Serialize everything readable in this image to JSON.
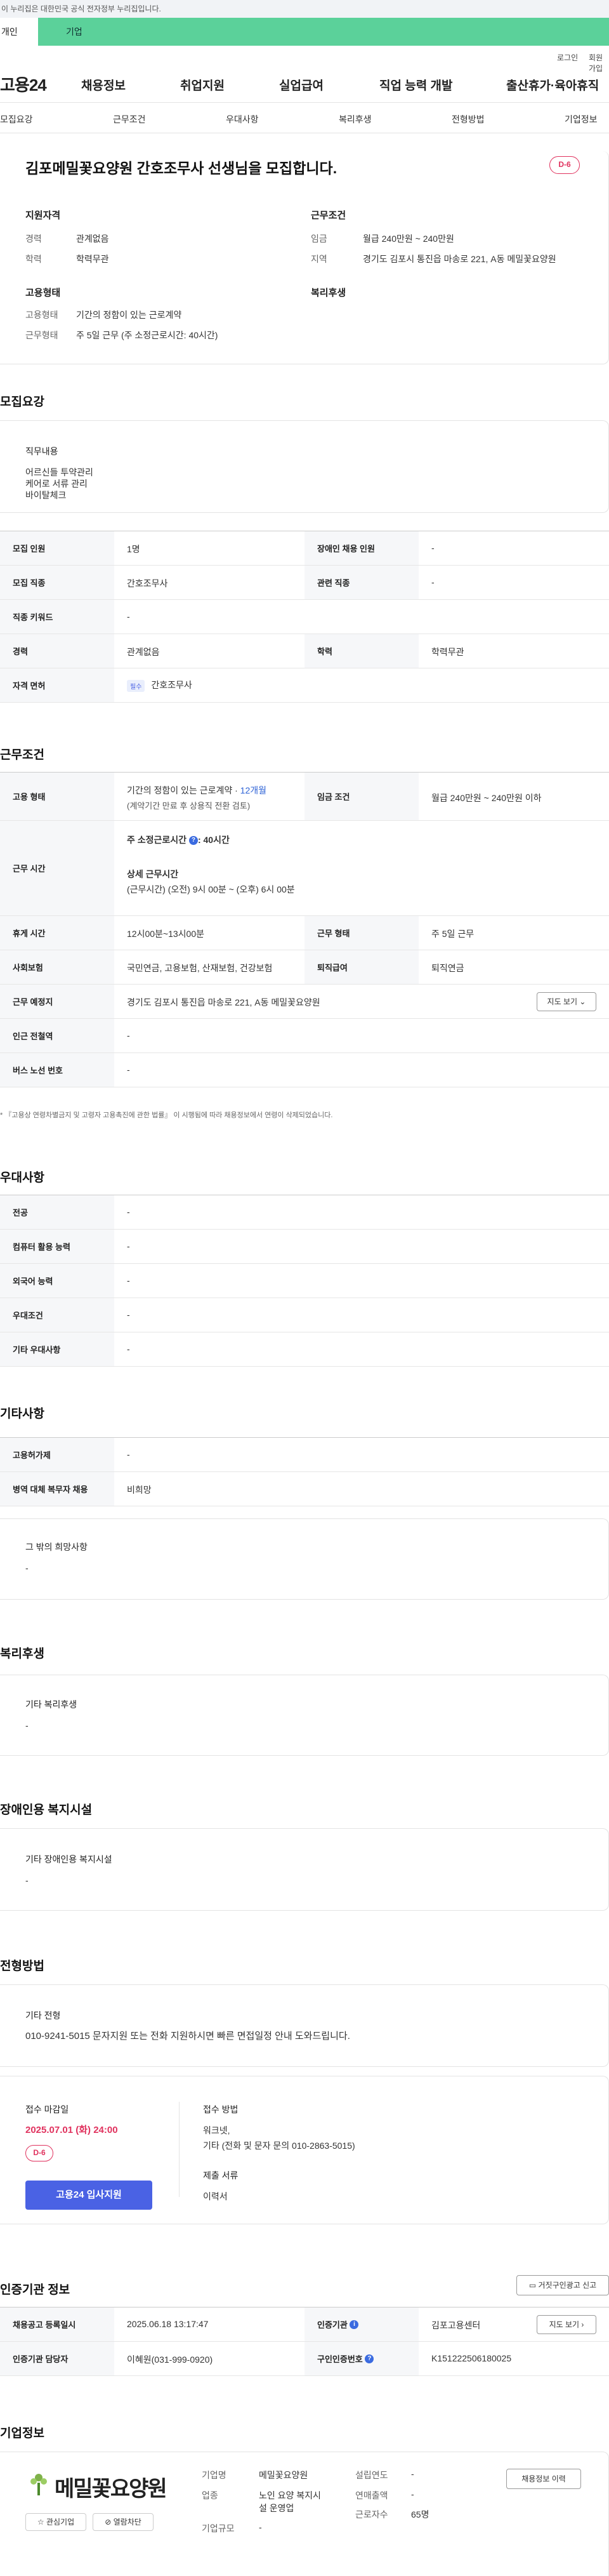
{
  "gov_bar": "이 누리집은 대한민국 공식 전자정부 누리집입니다.",
  "top_tabs": {
    "personal": "개인",
    "company": "기업"
  },
  "util": {
    "login": "로그인",
    "join": "회원가입"
  },
  "logo": "고용24",
  "gnb": [
    "채용정보",
    "취업지원",
    "실업급여",
    "직업 능력 개발",
    "출산휴가·육아휴직"
  ],
  "subnav": [
    "모집요강",
    "근무조건",
    "우대사항",
    "복리후생",
    "전형방법",
    "기업정보"
  ],
  "job": {
    "title": "김포메밀꽃요양원 간호조무사 선생님을 모집합니다.",
    "dday": "D-6",
    "summary": {
      "qual_head": "지원자격",
      "career_k": "경력",
      "career_v": "관계없음",
      "edu_k": "학력",
      "edu_v": "학력무관",
      "cond_head": "근무조건",
      "wage_k": "임금",
      "wage_v": "월급 240만원 ~ 240만원",
      "region_k": "지역",
      "region_v": "경기도 김포시 통진읍 마송로 221, A동 메밀꽃요양원",
      "emp_head": "고용형태",
      "emp_k": "고용형태",
      "emp_v": "기간의 정함이 있는 근로계약",
      "work_k": "근무형태",
      "work_v": "주 5일 근무 (주 소정근로시간: 40시간)",
      "welfare_head": "복리후생"
    }
  },
  "recruit": {
    "title": "모집요강",
    "duty_title": "직무내용",
    "duty_lines": [
      "어르신들 투약관리",
      "케어로 서류 관리",
      "바이탈체크"
    ],
    "rows": {
      "count_k": "모집 인원",
      "count_v": "1명",
      "disabled_k": "장애인 채용 인원",
      "disabled_v": "-",
      "job_k": "모집 직종",
      "job_v": "간호조무사",
      "related_k": "관련 직종",
      "related_v": "-",
      "keyword_k": "직종 키워드",
      "keyword_v": "-",
      "career_k": "경력",
      "career_v": "관계없음",
      "edu_k": "학력",
      "edu_v": "학력무관",
      "license_k": "자격 면허",
      "license_tag": "필수",
      "license_v": "간호조무사"
    }
  },
  "conditions": {
    "title": "근무조건",
    "emp_k": "고용 형태",
    "emp_v1": "기간의 정함이 있는 근로계약 · ",
    "emp_period": "12개월",
    "emp_v2": "(계약기간 만료 후 상용직 전환 검토)",
    "wage_k": "임금 조건",
    "wage_v": "월급 240만원 ~ 240만원 이하",
    "hours_k": "근무 시간",
    "hours_weekly_label": "주 소정근로시간",
    "hours_weekly_v": ": 40시간",
    "hours_detail_label": "상세 근무시간",
    "hours_detail_v": "(근무시간) (오전) 9시 00분 ~ (오후) 6시 00분",
    "break_k": "휴게 시간",
    "break_v": "12시00분~13시00분",
    "worktype_k": "근무 형태",
    "worktype_v": "주 5일 근무",
    "insurance_k": "사회보험",
    "insurance_v": "국민연금, 고용보험, 산재보험, 건강보험",
    "severance_k": "퇴직급여",
    "severance_v": "퇴직연금",
    "place_k": "근무 예정지",
    "place_v": "경기도 김포시 통진읍 마송로 221, A동 메밀꽃요양원",
    "map_btn": "지도 보기 ⌄",
    "subway_k": "인근 전철역",
    "subway_v": "-",
    "bus_k": "버스 노선 번호",
    "bus_v": "-",
    "note": "* 『고용상 연령차별금지 및 고령자 고용촉진에 관한 법률』 이 시행됨에 따라 채용정보에서 연령이 삭제되었습니다."
  },
  "preference": {
    "title": "우대사항",
    "rows": [
      {
        "k": "전공",
        "v": "-"
      },
      {
        "k": "컴퓨터 활용 능력",
        "v": "-"
      },
      {
        "k": "외국어 능력",
        "v": "-"
      },
      {
        "k": "우대조건",
        "v": "-"
      },
      {
        "k": "기타 우대사항",
        "v": "-"
      }
    ]
  },
  "etc": {
    "title": "기타사항",
    "rows": [
      {
        "k": "고용허가제",
        "v": "-"
      },
      {
        "k": "병역 대체 복무자 채용",
        "v": "비희망"
      }
    ],
    "other_title": "그 밖의 희망사항",
    "other_v": "-"
  },
  "welfare": {
    "title": "복리후생",
    "box_title": "기타 복리후생",
    "box_v": "-"
  },
  "disabled_fac": {
    "title": "장애인용 복지시설",
    "box_title": "기타 장애인용 복지시설",
    "box_v": "-"
  },
  "selection": {
    "title": "전형방법",
    "box_title": "기타 전형",
    "box_v": "010-9241-5015 문자지원 또는 전화 지원하시면 빠른 면접일정 안내 도와드립니다.",
    "deadline_label": "접수 마감일",
    "deadline_v": "2025.07.01 (화) 24:00",
    "dday": "D-6",
    "apply_btn": "고용24 입사지원",
    "method_label": "접수 방법",
    "method_v1": "워크넷,",
    "method_v2": "기타 (전화 및 문자 문의 010-2863-5015)",
    "docs_label": "제출 서류",
    "docs_v": "이력서"
  },
  "agency": {
    "title": "인증기관 정보",
    "report_btn": "거짓구인광고 신고",
    "reg_k": "채용공고 등록일시",
    "reg_v": "2025.06.18 13:17:47",
    "org_k": "인증기관",
    "org_v": "김포고용센터",
    "map_btn": "지도 보기 ›",
    "staff_k": "인증기관 담당자",
    "staff_v": "이혜원(031-999-0920)",
    "id_k": "구인인증번호",
    "id_v": "K151222506180025"
  },
  "company": {
    "title": "기업정보",
    "logo_text": "메밀꽃요양원",
    "interest_btn": "관심기업",
    "block_btn": "열람차단",
    "name_k": "기업명",
    "name_v": "메밀꽃요양원",
    "year_k": "설립연도",
    "year_v": "-",
    "industry_k": "업종",
    "industry_v1": "노인 요양 복지시",
    "industry_v2": "설 운영업",
    "sales_k": "연매출액",
    "sales_v": "-",
    "staff_k": "근로자수",
    "staff_v": "65명",
    "size_k": "기업규모",
    "size_v": "-",
    "jobs_btn": "채용정보 이력"
  }
}
